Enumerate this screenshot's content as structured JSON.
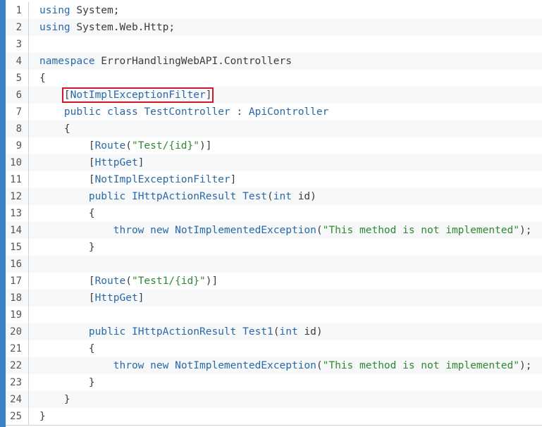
{
  "viewer": {
    "accent_bar_color": "#3b82c4",
    "highlight_color": "#d1192b"
  },
  "lines": [
    {
      "n": "1",
      "tokens": [
        {
          "t": "kw",
          "v": "using"
        },
        {
          "t": "plain",
          "v": " System;"
        }
      ]
    },
    {
      "n": "2",
      "tokens": [
        {
          "t": "kw",
          "v": "using"
        },
        {
          "t": "plain",
          "v": " System.Web.Http;"
        }
      ]
    },
    {
      "n": "3",
      "tokens": []
    },
    {
      "n": "4",
      "tokens": [
        {
          "t": "kw",
          "v": "namespace"
        },
        {
          "t": "plain",
          "v": " ErrorHandlingWebAPI.Controllers"
        }
      ]
    },
    {
      "n": "5",
      "tokens": [
        {
          "t": "plain",
          "v": "{"
        }
      ]
    },
    {
      "n": "6",
      "tokens": [
        {
          "t": "plain",
          "v": "    "
        },
        {
          "t": "plain",
          "v": "[",
          "hl_start": true
        },
        {
          "t": "kw",
          "v": "NotImplExceptionFilter"
        },
        {
          "t": "plain",
          "v": "]",
          "hl_end": true
        }
      ],
      "highlighted": true
    },
    {
      "n": "7",
      "tokens": [
        {
          "t": "plain",
          "v": "    "
        },
        {
          "t": "kw",
          "v": "public"
        },
        {
          "t": "plain",
          "v": " "
        },
        {
          "t": "kw",
          "v": "class"
        },
        {
          "t": "plain",
          "v": " "
        },
        {
          "t": "kw",
          "v": "TestController"
        },
        {
          "t": "plain",
          "v": " : "
        },
        {
          "t": "kw",
          "v": "ApiController"
        }
      ]
    },
    {
      "n": "8",
      "tokens": [
        {
          "t": "plain",
          "v": "    {"
        }
      ]
    },
    {
      "n": "9",
      "tokens": [
        {
          "t": "plain",
          "v": "        ["
        },
        {
          "t": "kw",
          "v": "Route"
        },
        {
          "t": "plain",
          "v": "("
        },
        {
          "t": "str",
          "v": "\"Test/{id}\""
        },
        {
          "t": "plain",
          "v": ")]"
        }
      ]
    },
    {
      "n": "10",
      "tokens": [
        {
          "t": "plain",
          "v": "        ["
        },
        {
          "t": "kw",
          "v": "HttpGet"
        },
        {
          "t": "plain",
          "v": "]"
        }
      ]
    },
    {
      "n": "11",
      "tokens": [
        {
          "t": "plain",
          "v": "        ["
        },
        {
          "t": "kw",
          "v": "NotImplExceptionFilter"
        },
        {
          "t": "plain",
          "v": "]"
        }
      ]
    },
    {
      "n": "12",
      "tokens": [
        {
          "t": "plain",
          "v": "        "
        },
        {
          "t": "kw",
          "v": "public"
        },
        {
          "t": "plain",
          "v": " "
        },
        {
          "t": "kw",
          "v": "IHttpActionResult"
        },
        {
          "t": "plain",
          "v": " "
        },
        {
          "t": "kw",
          "v": "Test"
        },
        {
          "t": "plain",
          "v": "("
        },
        {
          "t": "kw",
          "v": "int"
        },
        {
          "t": "plain",
          "v": " id)"
        }
      ]
    },
    {
      "n": "13",
      "tokens": [
        {
          "t": "plain",
          "v": "        {"
        }
      ]
    },
    {
      "n": "14",
      "tokens": [
        {
          "t": "plain",
          "v": "            "
        },
        {
          "t": "kw",
          "v": "throw"
        },
        {
          "t": "plain",
          "v": " "
        },
        {
          "t": "kw",
          "v": "new"
        },
        {
          "t": "plain",
          "v": " "
        },
        {
          "t": "kw",
          "v": "NotImplementedException"
        },
        {
          "t": "plain",
          "v": "("
        },
        {
          "t": "str",
          "v": "\"This method is not implemented\""
        },
        {
          "t": "plain",
          "v": ");"
        }
      ]
    },
    {
      "n": "15",
      "tokens": [
        {
          "t": "plain",
          "v": "        }"
        }
      ]
    },
    {
      "n": "16",
      "tokens": []
    },
    {
      "n": "17",
      "tokens": [
        {
          "t": "plain",
          "v": "        ["
        },
        {
          "t": "kw",
          "v": "Route"
        },
        {
          "t": "plain",
          "v": "("
        },
        {
          "t": "str",
          "v": "\"Test1/{id}\""
        },
        {
          "t": "plain",
          "v": ")]"
        }
      ]
    },
    {
      "n": "18",
      "tokens": [
        {
          "t": "plain",
          "v": "        ["
        },
        {
          "t": "kw",
          "v": "HttpGet"
        },
        {
          "t": "plain",
          "v": "]"
        }
      ]
    },
    {
      "n": "19",
      "tokens": []
    },
    {
      "n": "20",
      "tokens": [
        {
          "t": "plain",
          "v": "        "
        },
        {
          "t": "kw",
          "v": "public"
        },
        {
          "t": "plain",
          "v": " "
        },
        {
          "t": "kw",
          "v": "IHttpActionResult"
        },
        {
          "t": "plain",
          "v": " "
        },
        {
          "t": "kw",
          "v": "Test1"
        },
        {
          "t": "plain",
          "v": "("
        },
        {
          "t": "kw",
          "v": "int"
        },
        {
          "t": "plain",
          "v": " id)"
        }
      ]
    },
    {
      "n": "21",
      "tokens": [
        {
          "t": "plain",
          "v": "        {"
        }
      ]
    },
    {
      "n": "22",
      "tokens": [
        {
          "t": "plain",
          "v": "            "
        },
        {
          "t": "kw",
          "v": "throw"
        },
        {
          "t": "plain",
          "v": " "
        },
        {
          "t": "kw",
          "v": "new"
        },
        {
          "t": "plain",
          "v": " "
        },
        {
          "t": "kw",
          "v": "NotImplementedException"
        },
        {
          "t": "plain",
          "v": "("
        },
        {
          "t": "str",
          "v": "\"This method is not implemented\""
        },
        {
          "t": "plain",
          "v": ");"
        }
      ]
    },
    {
      "n": "23",
      "tokens": [
        {
          "t": "plain",
          "v": "        }"
        }
      ]
    },
    {
      "n": "24",
      "tokens": [
        {
          "t": "plain",
          "v": "    }"
        }
      ]
    },
    {
      "n": "25",
      "tokens": [
        {
          "t": "plain",
          "v": "}"
        }
      ]
    }
  ]
}
